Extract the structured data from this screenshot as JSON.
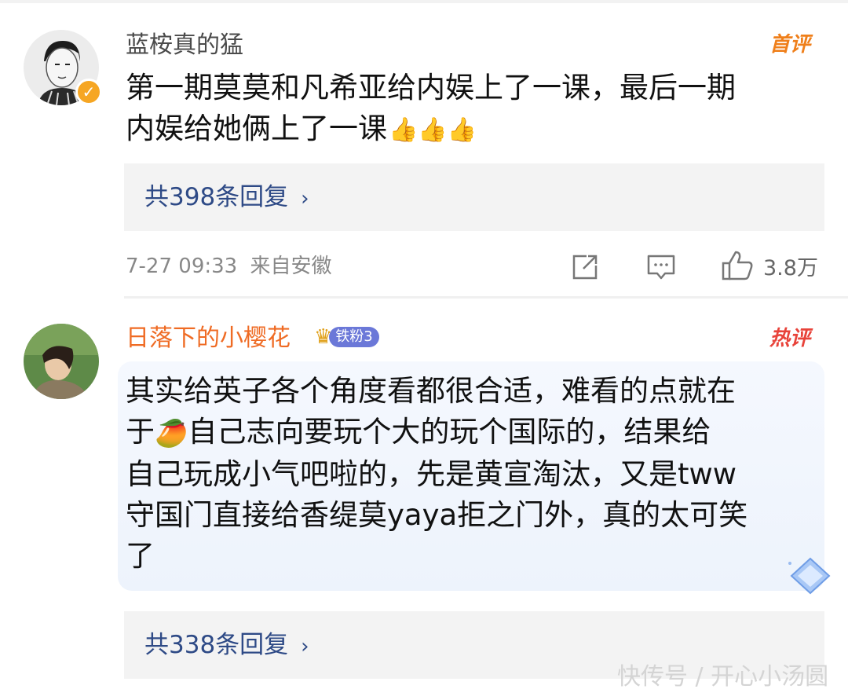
{
  "comments": [
    {
      "username": "蓝桉真的猛",
      "tag": "首评",
      "text_lines": [
        "第一期莫莫和凡希亚给内娱上了一课，最后一期",
        "内娱给她俩上了一课"
      ],
      "emoji": "👍👍👍",
      "replies_label": "共398条回复",
      "timestamp": "7-27 09:33",
      "source": "来自安徽",
      "like_count": "3.8万",
      "avatar_icon": "user-avatar",
      "verified_icon": "verified-badge-icon"
    },
    {
      "username": "日落下的小樱花",
      "fan_badge": "铁粉3",
      "tag": "热评",
      "text_line1": "其实给英子各个角度看都很合适，难看的点就在",
      "text_line2_a": "于",
      "text_line2_b": "自己志向要玩个大的玩个国际的，结果给",
      "text_lines_rest": [
        "自己玩成小气吧啦的，先是黄宣淘汰，又是tww",
        "守国门直接给香缇莫yaya拒之门外，真的太可笑",
        "了"
      ],
      "mango_emoji": "🥭",
      "replies_label": "共338条回复",
      "highlight_color": "#eef3fc"
    }
  ],
  "icons": {
    "share": "share-icon",
    "comment": "comment-icon",
    "like": "thumbs-up-icon",
    "chevron": "chevron-right-icon",
    "diamond": "diamond-icon",
    "crown": "crown-icon"
  },
  "watermark": "快传号 / 开心小汤圆",
  "colors": {
    "link": "#2e4a86",
    "username_highlight": "#ef6b24",
    "first_tag": "#ef7f1a",
    "hot_tag": "#e8433a",
    "fan_badge": "#6b78d8"
  }
}
